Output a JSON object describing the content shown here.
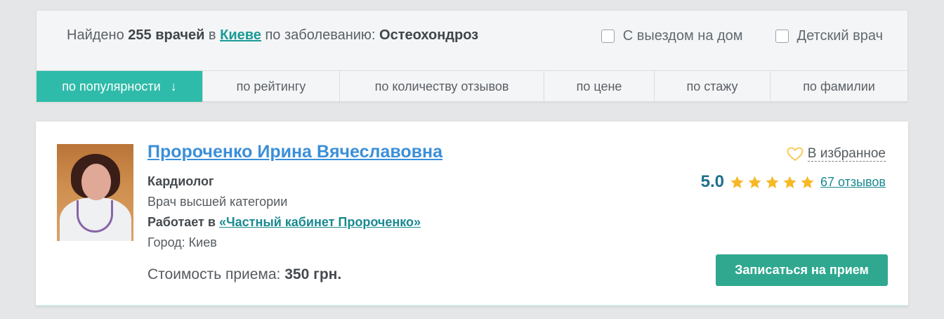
{
  "filter": {
    "found_prefix": "Найдено",
    "count_label": "255 врачей",
    "in_word": "в",
    "city": "Киеве",
    "disease_prefix": "по заболеванию:",
    "disease": "Остеохондроз",
    "checkboxes": [
      {
        "label": "С выездом на дом",
        "checked": false
      },
      {
        "label": "Детский врач",
        "checked": false
      }
    ]
  },
  "sort": {
    "tabs": [
      {
        "label": "по популярности",
        "active": true,
        "arrow": "↓"
      },
      {
        "label": "по рейтингу",
        "active": false
      },
      {
        "label": "по количеству отзывов",
        "active": false
      },
      {
        "label": "по цене",
        "active": false
      },
      {
        "label": "по стажу",
        "active": false
      },
      {
        "label": "по фамилии",
        "active": false
      }
    ]
  },
  "doctor": {
    "name": "Пророченко Ирина Вячеславовна",
    "specialty": "Кардиолог",
    "category": "Врач высшей категории",
    "works_prefix": "Работает в",
    "clinic": "«Частный кабинет Пророченко»",
    "city": "Город: Киев",
    "price_prefix": "Стоимость приема:",
    "price": "350 грн.",
    "favorite_label": "В избранное",
    "favorite_icon": "heart-icon",
    "rating": "5.0",
    "stars": 5,
    "reviews": "67 отзывов",
    "book_label": "Записаться на прием"
  },
  "colors": {
    "accent": "#2fbba9",
    "button": "#2fa88f",
    "link": "#3b8fd8",
    "star": "#f6b826",
    "score": "#1f6f8e"
  }
}
